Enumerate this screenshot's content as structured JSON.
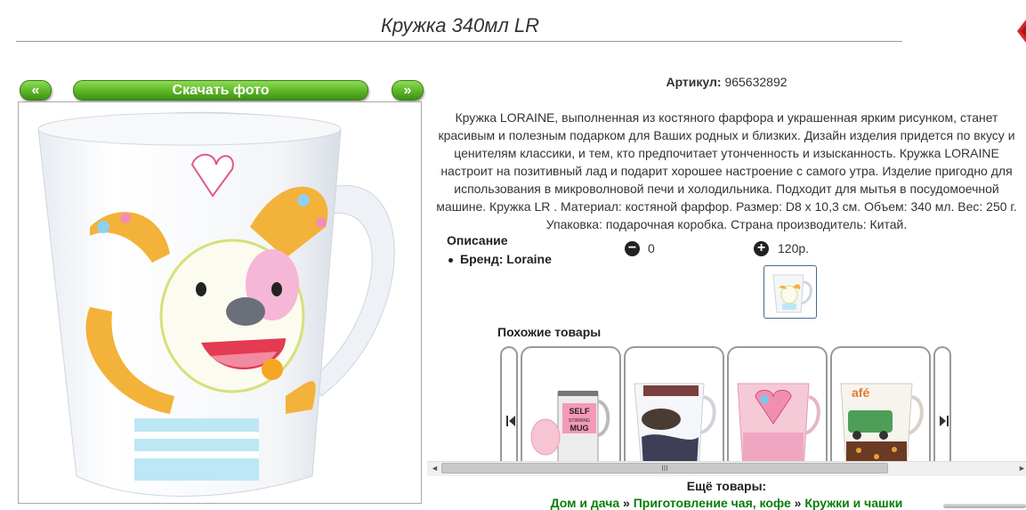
{
  "product": {
    "title": "Кружка 340мл LR",
    "article_label": "Артикул:",
    "article_value": "965632892",
    "description": "Кружка LORAINE, выполненная из костяного фарфора и украшенная ярким рисунком, станет красивым и полезным подарком для Ваших родных и близких. Дизайн изделия придется по вкусу и ценителям классики, и тем, кто предпочитает утонченность и изысканность. Кружка LORAINE настроит на позитивный лад и подарит хорошее настроение с самого утра. Изделие пригодно для использования в микроволновой печи и холодильника. Подходит для мытья в посудомоечной машине. Кружка LR . Материал: костяной фарфор. Размер: D8 х 10,3 см. Объем: 340 мл. Вес: 250 г. Упаковка: подарочная коробка. Страна производитель: Китай.",
    "specs_title": "Описание",
    "brand_label": "Бренд: Loraine",
    "quantity": "0",
    "price": "120р."
  },
  "gallery": {
    "prev_label": "«",
    "download_label": "Скачать фото",
    "next_label": "»"
  },
  "similar": {
    "title": "Похожие товары",
    "items": [
      {
        "text": "SELF STIRRING MUG"
      },
      {
        "text": ""
      },
      {
        "text": ""
      },
      {
        "text": ""
      }
    ]
  },
  "more": {
    "title": "Ещё товары:",
    "breadcrumb": [
      "Дом и дача",
      "Приготовление чая, кофе",
      "Кружки и чашки"
    ],
    "separator": "»"
  },
  "scrollbar": {
    "thumb_label": "III"
  },
  "colors": {
    "green_button": "#5cb526",
    "link_green": "#0a7d0a",
    "close_red": "#d9262c"
  }
}
